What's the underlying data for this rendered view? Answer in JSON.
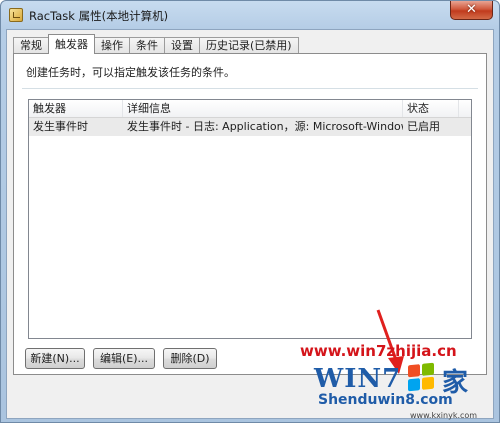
{
  "window": {
    "title": "RacTask 属性(本地计算机)",
    "close_label": "✕"
  },
  "tabs": [
    {
      "label": "常规",
      "active": false
    },
    {
      "label": "触发器",
      "active": true
    },
    {
      "label": "操作",
      "active": false
    },
    {
      "label": "条件",
      "active": false
    },
    {
      "label": "设置",
      "active": false
    },
    {
      "label": "历史记录(已禁用)",
      "active": false
    }
  ],
  "panel": {
    "description": "创建任务时，可以指定触发该任务的条件。"
  },
  "table": {
    "columns": [
      "触发器",
      "详细信息",
      "状态"
    ],
    "rows": [
      {
        "trigger": "发生事件时",
        "details": "发生事件时 - 日志: Application，源: Microsoft-Windows-CEI...",
        "status": "已启用"
      }
    ]
  },
  "buttons": {
    "new": "新建(N)...",
    "edit": "编辑(E)...",
    "delete": "删除(D)"
  },
  "watermark": {
    "url_top": "www.win7zhijia.cn",
    "brand_left": "WIN7",
    "brand_right": "家",
    "site_bottom": "Shenduwin8.com",
    "site_small": "www.kxinyk.com"
  },
  "colors": {
    "watermark_red": "#d4141a",
    "watermark_blue": "#1f5ca8",
    "flag": [
      "#f04e23",
      "#7fba00",
      "#00a4ef",
      "#ffb900"
    ]
  }
}
